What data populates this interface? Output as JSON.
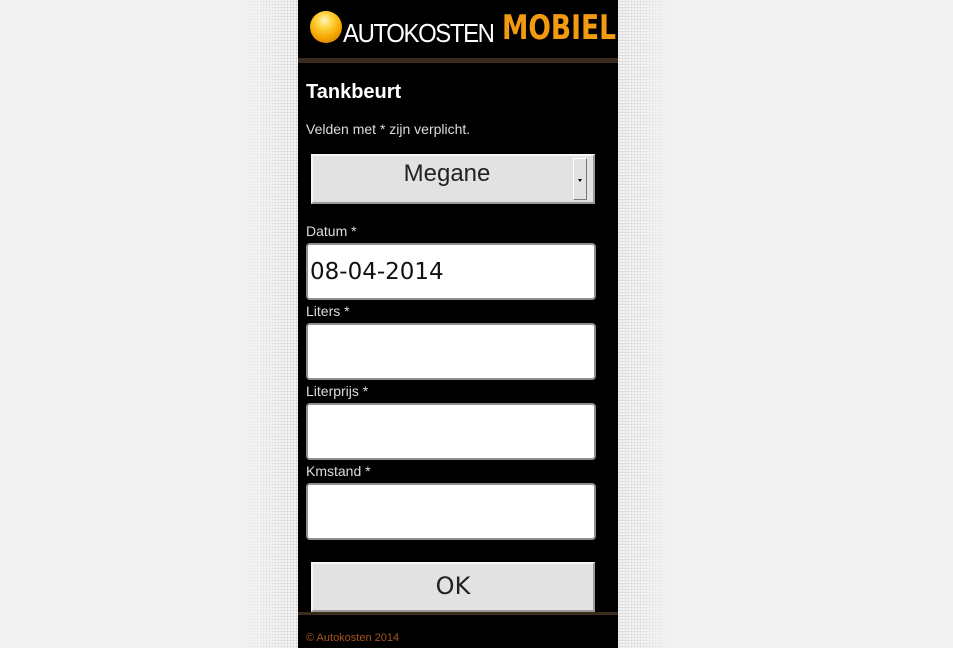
{
  "header": {
    "logo_word": "AUTOKOSTEN",
    "logo_accent": "MOBIEL"
  },
  "page": {
    "title": "Tankbeurt",
    "required_note": "Velden met * zijn verplicht."
  },
  "car_select": {
    "selected": "Megane"
  },
  "fields": {
    "datum": {
      "label": "Datum *",
      "value": "08-04-2014"
    },
    "liters": {
      "label": "Liters *",
      "value": ""
    },
    "literprijs": {
      "label": "Literprijs *",
      "value": ""
    },
    "kmstand": {
      "label": "Kmstand *",
      "value": ""
    }
  },
  "submit": {
    "label": "OK"
  },
  "footer": {
    "copyright": "© Autokosten 2014"
  },
  "colors": {
    "accent": "#f29a12",
    "background": "#000000",
    "footer_text": "#a8561e"
  },
  "icons": {
    "logo": "orange-ball-icon",
    "dropdown": "chevron-down-icon"
  }
}
